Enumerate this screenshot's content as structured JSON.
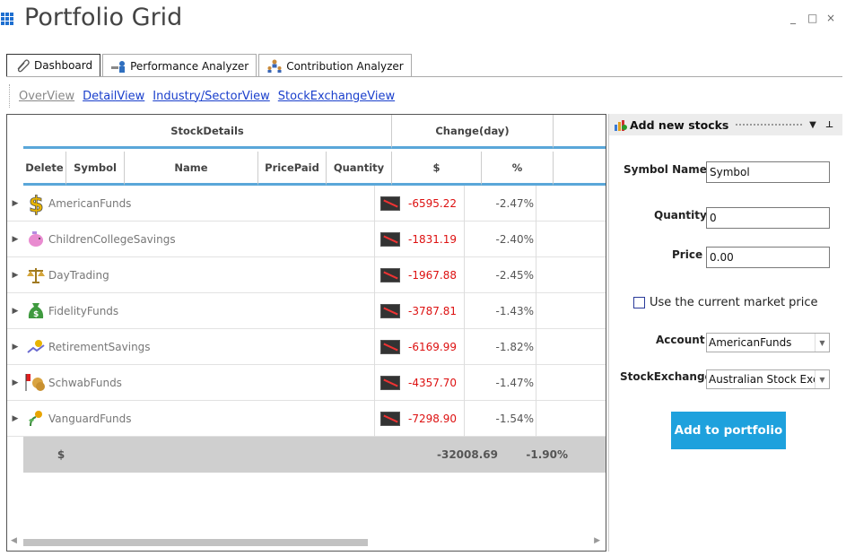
{
  "app": {
    "title": "Portfolio Grid"
  },
  "window": {
    "minimize": "_",
    "maximize": "□",
    "close": "×"
  },
  "tabs": [
    {
      "label": "Dashboard",
      "icon": "paperclip-icon",
      "active": true
    },
    {
      "label": "Performance Analyzer",
      "icon": "analyzer-icon",
      "active": false
    },
    {
      "label": "Contribution Analyzer",
      "icon": "people-icon",
      "active": false
    }
  ],
  "views": [
    "OverView",
    "DetailView",
    "Industry/SectorView",
    "StockExchangeView"
  ],
  "grid": {
    "bands": {
      "stock_details": "StockDetails",
      "change_day": "Change(day)"
    },
    "columns": {
      "delete": "Delete",
      "symbol": "Symbol",
      "name": "Name",
      "price_paid": "PricePaid",
      "quantity": "Quantity",
      "dollar": "$",
      "percent": "%"
    },
    "rows": [
      {
        "name": "AmericanFunds",
        "icon": "dollar-sign-icon",
        "change": "-6595.22",
        "percent": "-2.47%"
      },
      {
        "name": "ChildrenCollegeSavings",
        "icon": "piggy-bank-icon",
        "change": "-1831.19",
        "percent": "-2.40%"
      },
      {
        "name": "DayTrading",
        "icon": "scales-icon",
        "change": "-1967.88",
        "percent": "-2.45%"
      },
      {
        "name": "FidelityFunds",
        "icon": "money-bag-icon",
        "change": "-3787.81",
        "percent": "-1.43%"
      },
      {
        "name": "RetirementSavings",
        "icon": "retirement-icon",
        "change": "-6169.99",
        "percent": "-1.82%"
      },
      {
        "name": "SchwabFunds",
        "icon": "coins-flag-icon",
        "change": "-4357.70",
        "percent": "-1.47%"
      },
      {
        "name": "VanguardFunds",
        "icon": "plant-coin-icon",
        "change": "-7298.90",
        "percent": "-1.54%"
      }
    ],
    "summary": {
      "label": "$",
      "total_change": "-32008.69",
      "total_percent": "-1.90%"
    }
  },
  "panel": {
    "title": "Add new stocks",
    "symbol_label": "Symbol Name",
    "symbol_value": "Symbol",
    "quantity_label": "Quantity",
    "quantity_value": "0",
    "price_label": "Price",
    "price_value": "0.00",
    "use_market_price": "Use the current market price",
    "account_label": "Account",
    "account_value": "AmericanFunds",
    "exchange_label": "StockExchange",
    "exchange_value": "Australian Stock Excha",
    "add_button": "Add to portfolio"
  },
  "colors": {
    "accent": "#1ea1dd",
    "band_line": "#5aa7d9",
    "negative": "#dd1111",
    "link": "#1a3fcc"
  }
}
